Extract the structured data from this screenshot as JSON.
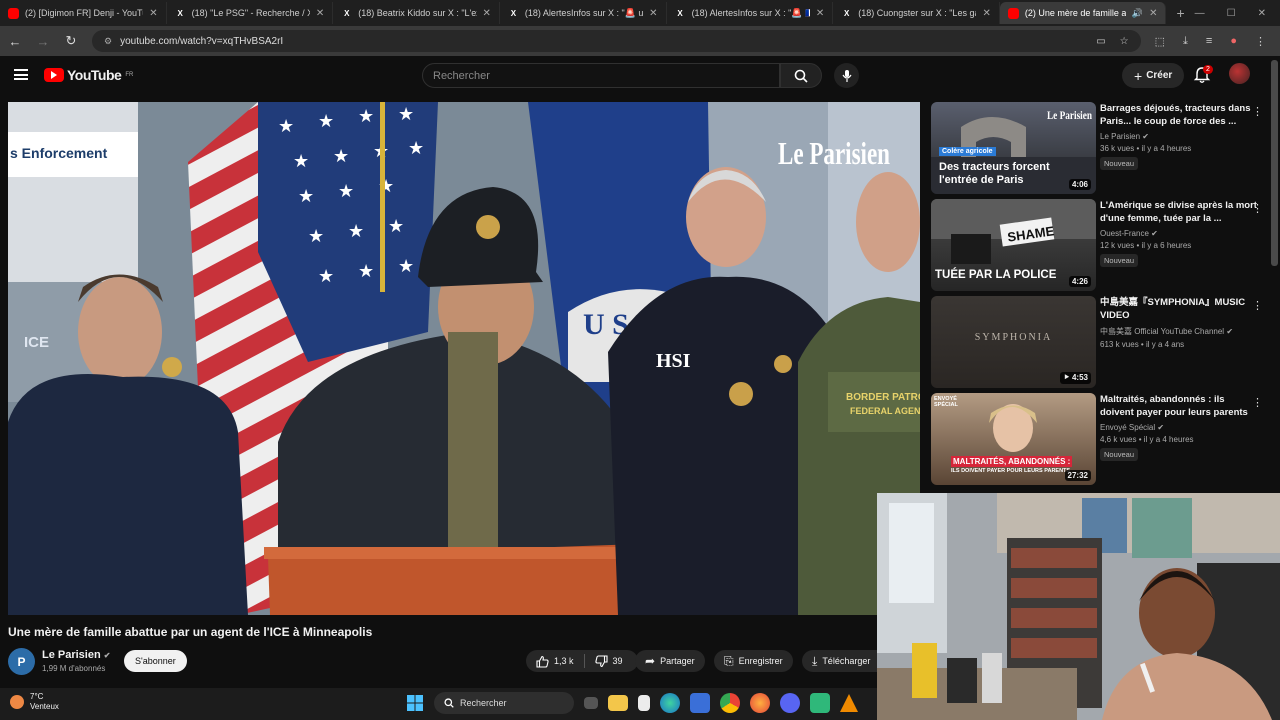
{
  "browser": {
    "tabs": [
      {
        "label": "(2) [Digimon FR] Denji - YouTub",
        "fav": "yt"
      },
      {
        "label": "(18) \"Le PSG\" - Recherche / X",
        "fav": "x"
      },
      {
        "label": "(18) Beatrix Kiddo sur X : \"L'exti",
        "fav": "x"
      },
      {
        "label": "(18) AlertesInfos sur X : \"🚨 us •",
        "fav": "x"
      },
      {
        "label": "(18) AlertesInfos sur X : \"🚨 🇫🇷",
        "fav": "x"
      },
      {
        "label": "(18) Cuongster sur X : \"Les gar",
        "fav": "x"
      },
      {
        "label": "(2) Une mère de famille ab",
        "fav": "yt",
        "active": true
      }
    ],
    "url": "youtube.com/watch?v=xqTHvBSA2rI"
  },
  "youtube": {
    "logo_text": "YouTube",
    "region": "FR",
    "search_placeholder": "Rechercher",
    "create_label": "Créer",
    "notif_count": "2"
  },
  "video": {
    "title": "Une mère de famille abattue par un agent de l'ICE à Minneapolis",
    "overlay_brand": "Le Parisien",
    "banner_text": "s Enforcement",
    "podium_seal": "U S",
    "jacket_hsi": "HSI",
    "jacket_ice": "ICE",
    "jacket_border": "BORDER PATROL",
    "jacket_federal": "FEDERAL AGENT"
  },
  "channel": {
    "name": "Le Parisien",
    "initial": "P",
    "subscribers": "1,99 M d'abonnés",
    "subscribe_label": "S'abonner"
  },
  "actions": {
    "likes": "1,3 k",
    "dislikes": "39",
    "share": "Partager",
    "save": "Enregistrer",
    "download": "Télécharger"
  },
  "recommendations": [
    {
      "title": "Barrages déjoués, tracteurs dans Paris... le coup de force des ...",
      "channel": "Le Parisien",
      "meta": "36 k vues • il y a 4 heures",
      "badge": "Nouveau",
      "duration": "4:06",
      "thumb_tag": "Colère agricole",
      "thumb_caption": "Des tracteurs forcent l'entrée de Paris",
      "thumb_brand": "Le Parisien"
    },
    {
      "title": "L'Amérique se divise après la mort d'une femme, tuée par la ...",
      "channel": "Ouest-France",
      "meta": "12 k vues • il y a 6 heures",
      "badge": "Nouveau",
      "duration": "4:26",
      "thumb_caption": "TUÉE PAR LA POLICE",
      "thumb_sign": "SHAME"
    },
    {
      "title": "中島美嘉『SYMPHONIA』MUSIC VIDEO",
      "channel": "中島美嘉 Official YouTube Channel",
      "meta": "613 k vues • il y a 4 ans",
      "badge": "",
      "duration": "4:53",
      "thumb_caption": "SYMPHONIA"
    },
    {
      "title": "Maltraités, abandonnés : ils doivent payer pour leurs parents",
      "channel": "Envoyé Spécial",
      "meta": "4,6 k vues • il y a 4 heures",
      "badge": "Nouveau",
      "duration": "27:32",
      "thumb_caption": "MALTRAITÉS, ABANDONNÉS :",
      "thumb_sub": "ILS DOIVENT PAYER POUR LEURS PARENTS",
      "thumb_tag": "ENVOYÉ SPÉCIAL"
    }
  ],
  "taskbar": {
    "temp": "7°C",
    "weather": "Venteux",
    "search": "Rechercher"
  },
  "colors": {
    "bg": "#0f0f0f",
    "accent_red": "#ff0000",
    "chip": "#272727"
  }
}
